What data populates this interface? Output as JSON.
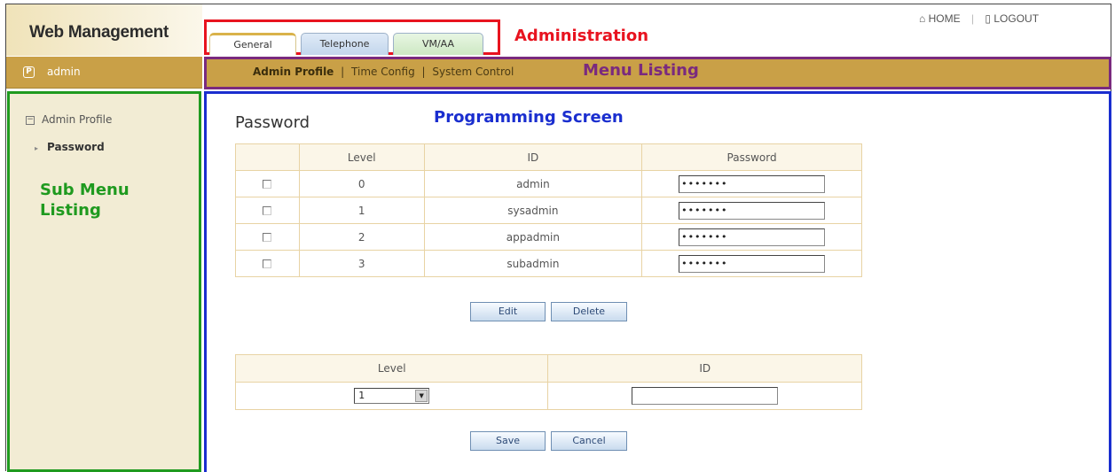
{
  "header": {
    "logo": "Web Management",
    "home": "HOME",
    "logout": "LOGOUT",
    "separator": "|"
  },
  "tabs": [
    {
      "label": "General",
      "active": true
    },
    {
      "label": "Telephone",
      "active": false
    },
    {
      "label": "VM/AA",
      "active": false
    }
  ],
  "annotations": {
    "administration": "Administration",
    "menu_listing": "Menu Listing",
    "sub_menu_listing": "Sub Menu Listing",
    "programming_screen": "Programming Screen"
  },
  "user": {
    "icon_glyph": "P",
    "name": "admin"
  },
  "menu": {
    "items": [
      "Admin Profile",
      "Time Config",
      "System Control"
    ],
    "separator": "|"
  },
  "sidebar": {
    "group": "Admin Profile",
    "expand_glyph": "−",
    "item": "Password"
  },
  "main": {
    "title": "Password",
    "password_table": {
      "headers": [
        "",
        "Level",
        "ID",
        "Password"
      ],
      "rows": [
        {
          "level": "0",
          "id": "admin",
          "password": "•••••••"
        },
        {
          "level": "1",
          "id": "sysadmin",
          "password": "•••••••"
        },
        {
          "level": "2",
          "id": "appadmin",
          "password": "•••••••"
        },
        {
          "level": "3",
          "id": "subadmin",
          "password": "•••••••"
        }
      ]
    },
    "edit_label": "Edit",
    "delete_label": "Delete",
    "add_table": {
      "headers": [
        "Level",
        "ID"
      ],
      "level_value": "1",
      "id_value": ""
    },
    "save_label": "Save",
    "cancel_label": "Cancel"
  },
  "colors": {
    "administration": "#e8131f",
    "menu_listing": "#7a2a7e",
    "sub_menu": "#1f9a1f",
    "programming": "#1a2ecf",
    "bar": "#c9a047"
  }
}
